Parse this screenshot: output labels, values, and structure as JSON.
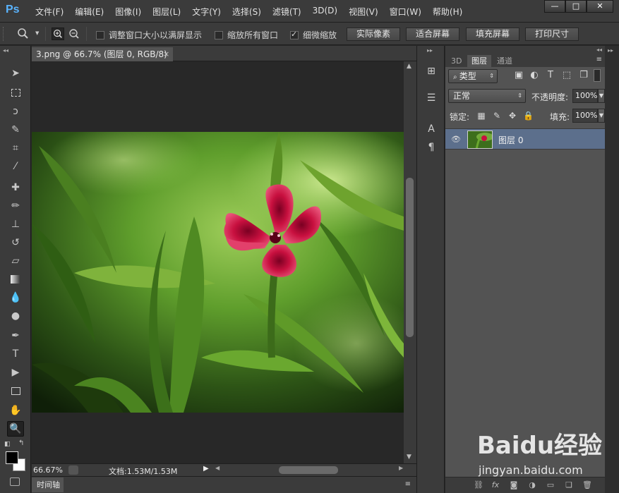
{
  "app": {
    "logo": "Ps"
  },
  "menu": [
    "文件(F)",
    "编辑(E)",
    "图像(I)",
    "图层(L)",
    "文字(Y)",
    "选择(S)",
    "滤镜(T)",
    "3D(D)",
    "视图(V)",
    "窗口(W)",
    "帮助(H)"
  ],
  "window_controls": {
    "minimize": "—",
    "restore": "□",
    "close": "✕"
  },
  "options_bar": {
    "resize_windows": {
      "label": "调整窗口大小以满屏显示",
      "checked": false
    },
    "zoom_all": {
      "label": "缩放所有窗口",
      "checked": false
    },
    "scrubby_zoom": {
      "label": "细微缩放",
      "checked": true
    },
    "buttons": [
      "实际像素",
      "适合屏幕",
      "填充屏幕",
      "打印尺寸"
    ]
  },
  "document": {
    "tab_title": "3.png @ 66.7% (图层 0, RGB/8)",
    "close_glyph": "×"
  },
  "status": {
    "zoom": "66.67%",
    "doc_info": "文档:1.53M/1.53M"
  },
  "timeline": {
    "label": "时间轴"
  },
  "panel": {
    "tabs": [
      "3D",
      "图层",
      "通道"
    ],
    "active_tab": "图层",
    "filter_kind": "类型",
    "blend_mode": "正常",
    "opacity_label": "不透明度:",
    "opacity_value": "100%",
    "lock_label": "锁定:",
    "fill_label": "填充:",
    "fill_value": "100%",
    "layers": [
      {
        "name": "图层 0",
        "visible": true
      }
    ],
    "footer_fx": "fx"
  },
  "watermark": {
    "logo": "Baidu经验",
    "url": "jingyan.baidu.com"
  },
  "colors": {
    "chrome": "#3b3b3b",
    "canvas_bg": "#282828",
    "panel_bg": "#535353",
    "selected_layer": "#5c6f8c",
    "ps_blue": "#5ab4ff"
  }
}
